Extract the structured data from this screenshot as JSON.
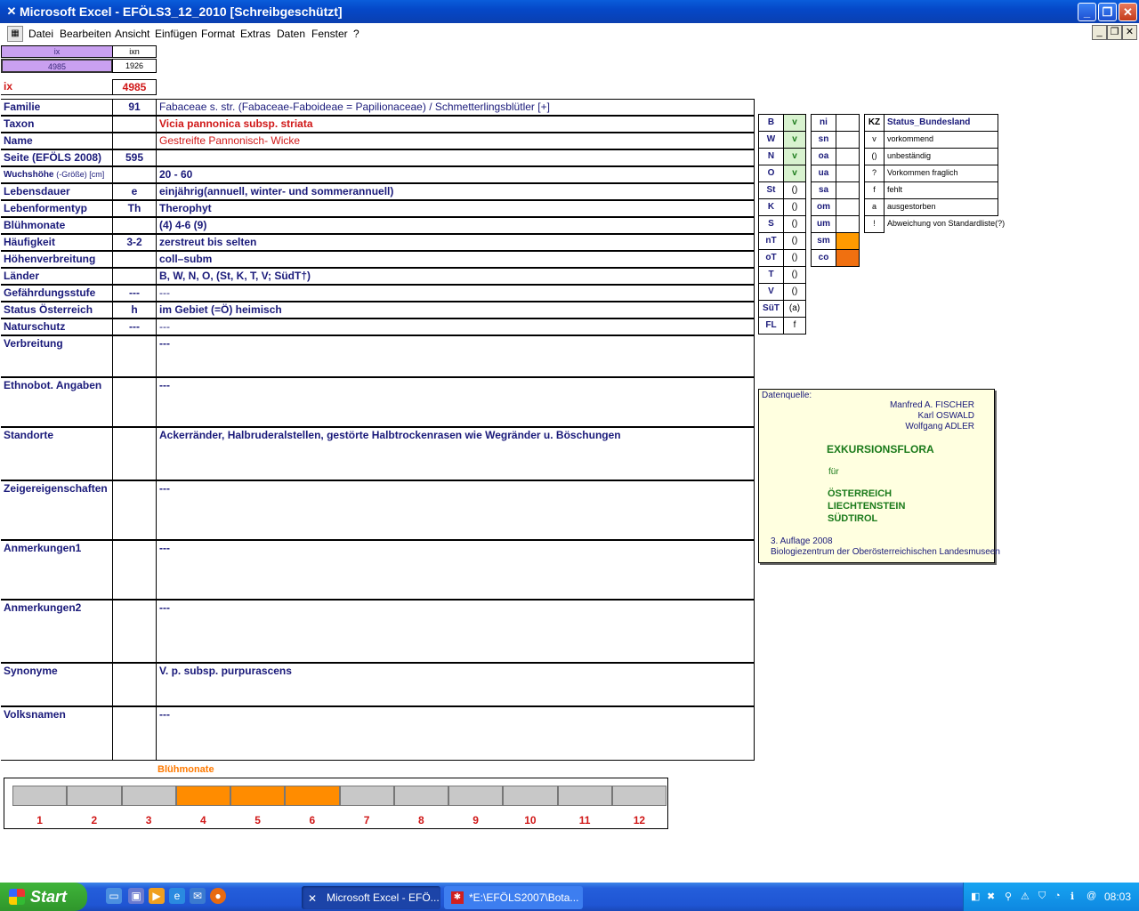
{
  "window": {
    "title": "Microsoft Excel - EFÖLS3_12_2010  [Schreibgeschützt]"
  },
  "menu": [
    "Datei",
    "Bearbeiten",
    "Ansicht",
    "Einfügen",
    "Format",
    "Extras",
    "Daten",
    "Fenster",
    "?"
  ],
  "topcells": {
    "ix_label": "ix",
    "ixn_label": "ixn",
    "ix_value": "4985",
    "ixn_value": "1926",
    "ix_row_label": "ix",
    "ix_row_value": "4985"
  },
  "rows": [
    {
      "label": "Familie",
      "code": "91",
      "value": "Fabaceae s. str. (Fabaceae-Faboideae = Papilionaceae)  /  Schmetterlingsblütler [+]"
    },
    {
      "label": "Taxon",
      "code": "",
      "value": "Vicia pannonica subsp. striata"
    },
    {
      "label": "Name",
      "code": "",
      "value": "Gestreifte Pannonisch- Wicke"
    },
    {
      "label": "Seite (EFÖLS 2008)",
      "code": "595",
      "value": ""
    },
    {
      "label": "Wuchshöhe",
      "label_extra": "(-Größe) [cm]",
      "code": "",
      "value": "20 - 60"
    },
    {
      "label": "Lebensdauer",
      "code": "e",
      "value": "einjährig(annuell, winter- und sommerannuell)"
    },
    {
      "label": "Lebenformentyp",
      "code": "Th",
      "value": "Therophyt"
    },
    {
      "label": "Blühmonate",
      "code": "",
      "value": "(4) 4-6 (9)"
    },
    {
      "label": "Häufigkeit",
      "code": "3-2",
      "value": "zerstreut bis selten"
    },
    {
      "label": "Höhenverbreitung",
      "code": "",
      "value": "coll–subm"
    },
    {
      "label": "Länder",
      "code": "",
      "value": "B, W, N, O, (St, K, T, V; SüdT†)"
    },
    {
      "label": "Gefährdungsstufe",
      "code": "---",
      "value": "---"
    },
    {
      "label": "Status Österreich",
      "code": "h",
      "value": "im Gebiet (=Ö) heimisch"
    },
    {
      "label": "Naturschutz",
      "code": "---",
      "value": "---"
    },
    {
      "label": "Verbreitung",
      "code": "",
      "value": "---"
    },
    {
      "label": "Ethnobot. Angaben",
      "code": "",
      "value": "---"
    },
    {
      "label": "Standorte",
      "code": "",
      "value": "Ackerränder, Halbruderalstellen, gestörte Halbtrockenrasen wie Wegränder u. Böschungen"
    },
    {
      "label": "Zeigereigenschaften",
      "code": "",
      "value": "---"
    },
    {
      "label": "Anmerkungen1",
      "code": "",
      "value": "---"
    },
    {
      "label": "Anmerkungen2",
      "code": "",
      "value": "---"
    },
    {
      "label": "Synonyme",
      "code": "",
      "value": "V. p. subsp. purpurascens"
    },
    {
      "label": "Volksnamen",
      "code": "",
      "value": "---"
    }
  ],
  "laender": [
    {
      "k": "B",
      "v": "v"
    },
    {
      "k": "W",
      "v": "v"
    },
    {
      "k": "N",
      "v": "v"
    },
    {
      "k": "O",
      "v": "v"
    },
    {
      "k": "St",
      "v": "()"
    },
    {
      "k": "K",
      "v": "()"
    },
    {
      "k": "S",
      "v": "()"
    },
    {
      "k": "nT",
      "v": "()"
    },
    {
      "k": "oT",
      "v": "()"
    },
    {
      "k": "T",
      "v": "()"
    },
    {
      "k": "V",
      "v": "()"
    },
    {
      "k": "SüT",
      "v": "(a)"
    },
    {
      "k": "FL",
      "v": "f"
    }
  ],
  "stufen": [
    "ni",
    "sn",
    "oa",
    "ua",
    "sa",
    "om",
    "um",
    "sm",
    "co"
  ],
  "status_legend": {
    "kz_header": "KZ",
    "status_header": "Status_Bundesland",
    "items": [
      {
        "k": "v",
        "v": "vorkommend"
      },
      {
        "k": "()",
        "v": "unbeständig"
      },
      {
        "k": "?",
        "v": "Vorkommen fraglich"
      },
      {
        "k": "f",
        "v": "fehlt"
      },
      {
        "k": "a",
        "v": "ausgestorben"
      },
      {
        "k": "!",
        "v": "Abweichung von Standardliste(?)"
      }
    ]
  },
  "datenquelle": {
    "label": "Datenquelle:",
    "authors": [
      "Manfred A. FISCHER",
      "Karl OSWALD",
      "Wolfgang ADLER"
    ],
    "title": "EXKURSIONSFLORA",
    "fuer": "für",
    "countries": [
      "ÖSTERREICH",
      "LIECHTENSTEIN",
      "SÜDTIROL"
    ],
    "edition": "3. Auflage 2008",
    "publisher": "Biologiezentrum der Oberösterreichischen Landesmuseen"
  },
  "bluehmonate": {
    "title": "Blühmonate",
    "months": [
      "1",
      "2",
      "3",
      "4",
      "5",
      "6",
      "7",
      "8",
      "9",
      "10",
      "11",
      "12"
    ],
    "active": [
      4,
      5,
      6
    ]
  },
  "taskbar": {
    "start": "Start",
    "tasks": [
      "Microsoft Excel - EFÖ...",
      "*E:\\EFÖLS2007\\Bota..."
    ],
    "clock": "08:03"
  },
  "colors": {
    "accent_purple": "#c9a0f0",
    "highlight_orange": "#ff8c00",
    "green": "#d8f2cf"
  }
}
